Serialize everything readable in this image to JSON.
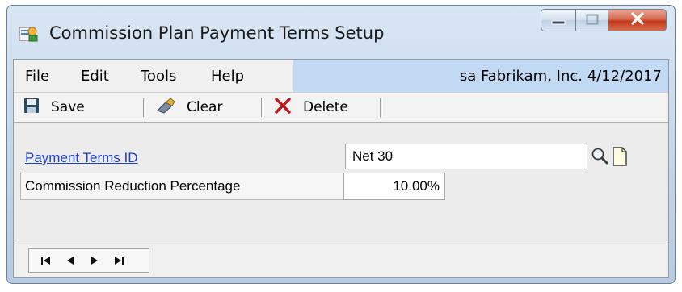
{
  "window": {
    "title": "Commission Plan Payment Terms Setup",
    "icons": {
      "app": "window-app-icon",
      "minimize": "minimize-icon",
      "maximize": "maximize-icon",
      "close": "close-icon"
    }
  },
  "menubar": {
    "items": [
      {
        "label": "File"
      },
      {
        "label": "Edit"
      },
      {
        "label": "Tools"
      },
      {
        "label": "Help"
      }
    ],
    "user_info": "sa  Fabrikam, Inc.  4/12/2017"
  },
  "toolbar": {
    "save_label": "Save",
    "clear_label": "Clear",
    "delete_label": "Delete",
    "icons": {
      "save": "floppy-disk-icon",
      "clear": "eraser-icon",
      "delete": "red-x-icon"
    }
  },
  "form": {
    "payment_terms_id_label": "Payment Terms ID",
    "payment_terms_id_value": "Net 30",
    "commission_reduction_label": "Commission Reduction Percentage",
    "commission_reduction_value": "10.00%",
    "icons": {
      "lookup": "magnifier-icon",
      "new": "new-document-icon"
    }
  },
  "navigation": {
    "icons": [
      "first-record-icon",
      "previous-record-icon",
      "next-record-icon",
      "last-record-icon"
    ]
  },
  "colors": {
    "link": "#1b3fd6",
    "menubar_highlight": "#c2d9f3",
    "close_button": "#c4391c",
    "delete_icon": "#c0151a"
  }
}
